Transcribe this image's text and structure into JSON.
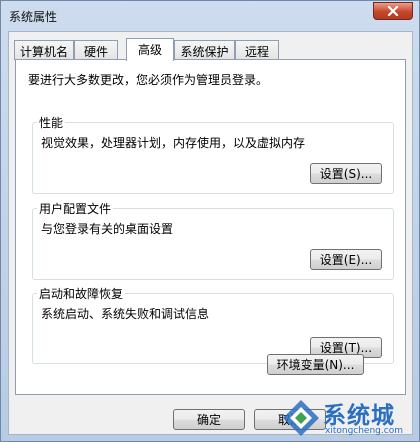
{
  "window": {
    "title": "系统属性"
  },
  "tabs": [
    {
      "label": "计算机名",
      "active": false
    },
    {
      "label": "硬件",
      "active": false
    },
    {
      "label": "高级",
      "active": true
    },
    {
      "label": "系统保护",
      "active": false
    },
    {
      "label": "远程",
      "active": false
    }
  ],
  "notice": "要进行大多数更改，您必须作为管理员登录。",
  "groups": [
    {
      "title": "性能",
      "description": "视觉效果，处理器计划，内存使用，以及虚拟内存",
      "button": "设置(S)..."
    },
    {
      "title": "用户配置文件",
      "description": "与您登录有关的桌面设置",
      "button": "设置(E)..."
    },
    {
      "title": "启动和故障恢复",
      "description": "系统启动、系统失败和调试信息",
      "button": "设置(T)..."
    }
  ],
  "env_button": "环境变量(N)...",
  "footer": {
    "ok": "确定",
    "cancel": "取消"
  },
  "watermark": {
    "text": "系统城",
    "url": "xitongcheng.com",
    "color": "#2a6fc2"
  }
}
